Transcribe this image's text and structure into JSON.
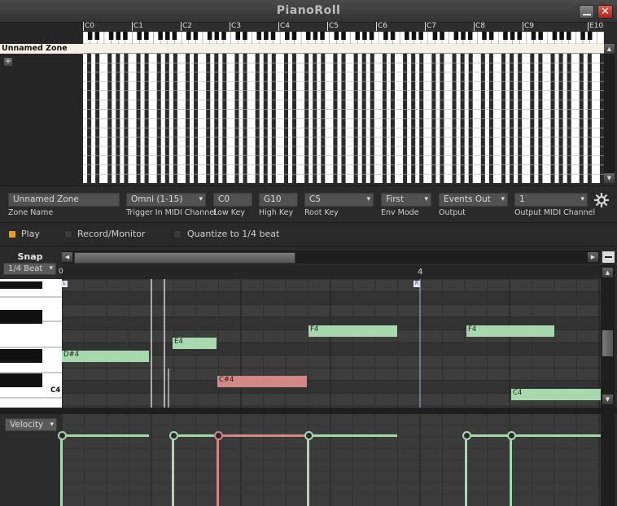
{
  "window": {
    "title": "PianoRoll",
    "minimize_glyph": "—",
    "close_glyph": "✕"
  },
  "zone_list": {
    "selected_zone": "Unnamed Zone",
    "add_label": "+"
  },
  "keyboard_ruler": {
    "octaves": [
      "C0",
      "C1",
      "C2",
      "C3",
      "C4",
      "C5",
      "C6",
      "C7",
      "C8",
      "C9",
      "E10"
    ]
  },
  "zone_props": {
    "zone_name": {
      "value": "Unnamed Zone",
      "label": "Zone Name"
    },
    "trigger_channel": {
      "value": "Omni (1-15)",
      "label": "Trigger In MIDI Channel"
    },
    "low_key": {
      "value": "C0",
      "label": "Low Key"
    },
    "high_key": {
      "value": "G10",
      "label": "High Key"
    },
    "root_key": {
      "value": "C5",
      "label": "Root Key"
    },
    "env_mode": {
      "value": "First",
      "label": "Env Mode"
    },
    "output": {
      "value": "Events Out",
      "label": "Output"
    },
    "output_channel": {
      "value": "1",
      "label": "Output MIDI Channel"
    },
    "settings_icon": "gear-icon"
  },
  "transport": {
    "play": "Play",
    "record": "Record/Monitor",
    "quantize": "Quantize to 1/4 beat",
    "play_on": true,
    "record_on": false,
    "quantize_on": false
  },
  "piano_roll": {
    "snap_label": "Snap",
    "snap_value": "1/4 Beat",
    "beat_marker": "4",
    "loop_left": "L",
    "loop_right": "R",
    "key_label": "C4",
    "notes": [
      {
        "label": "D#4",
        "color": "#a8d8ae"
      },
      {
        "label": "E4",
        "color": "#a8d8ae"
      },
      {
        "label": "F4",
        "color": "#a8d8ae"
      },
      {
        "label": "F4",
        "color": "#a8d8ae"
      },
      {
        "label": "C#4",
        "color": "#d38888"
      },
      {
        "label": "C4",
        "color": "#a8d8ae"
      }
    ]
  },
  "velocity": {
    "lane_select": "Velocity"
  },
  "colors": {
    "note_green": "#a8d8ae",
    "note_selected": "#d38888",
    "play_active": "#e8a021",
    "grid_bg": "#3b3b3b"
  }
}
